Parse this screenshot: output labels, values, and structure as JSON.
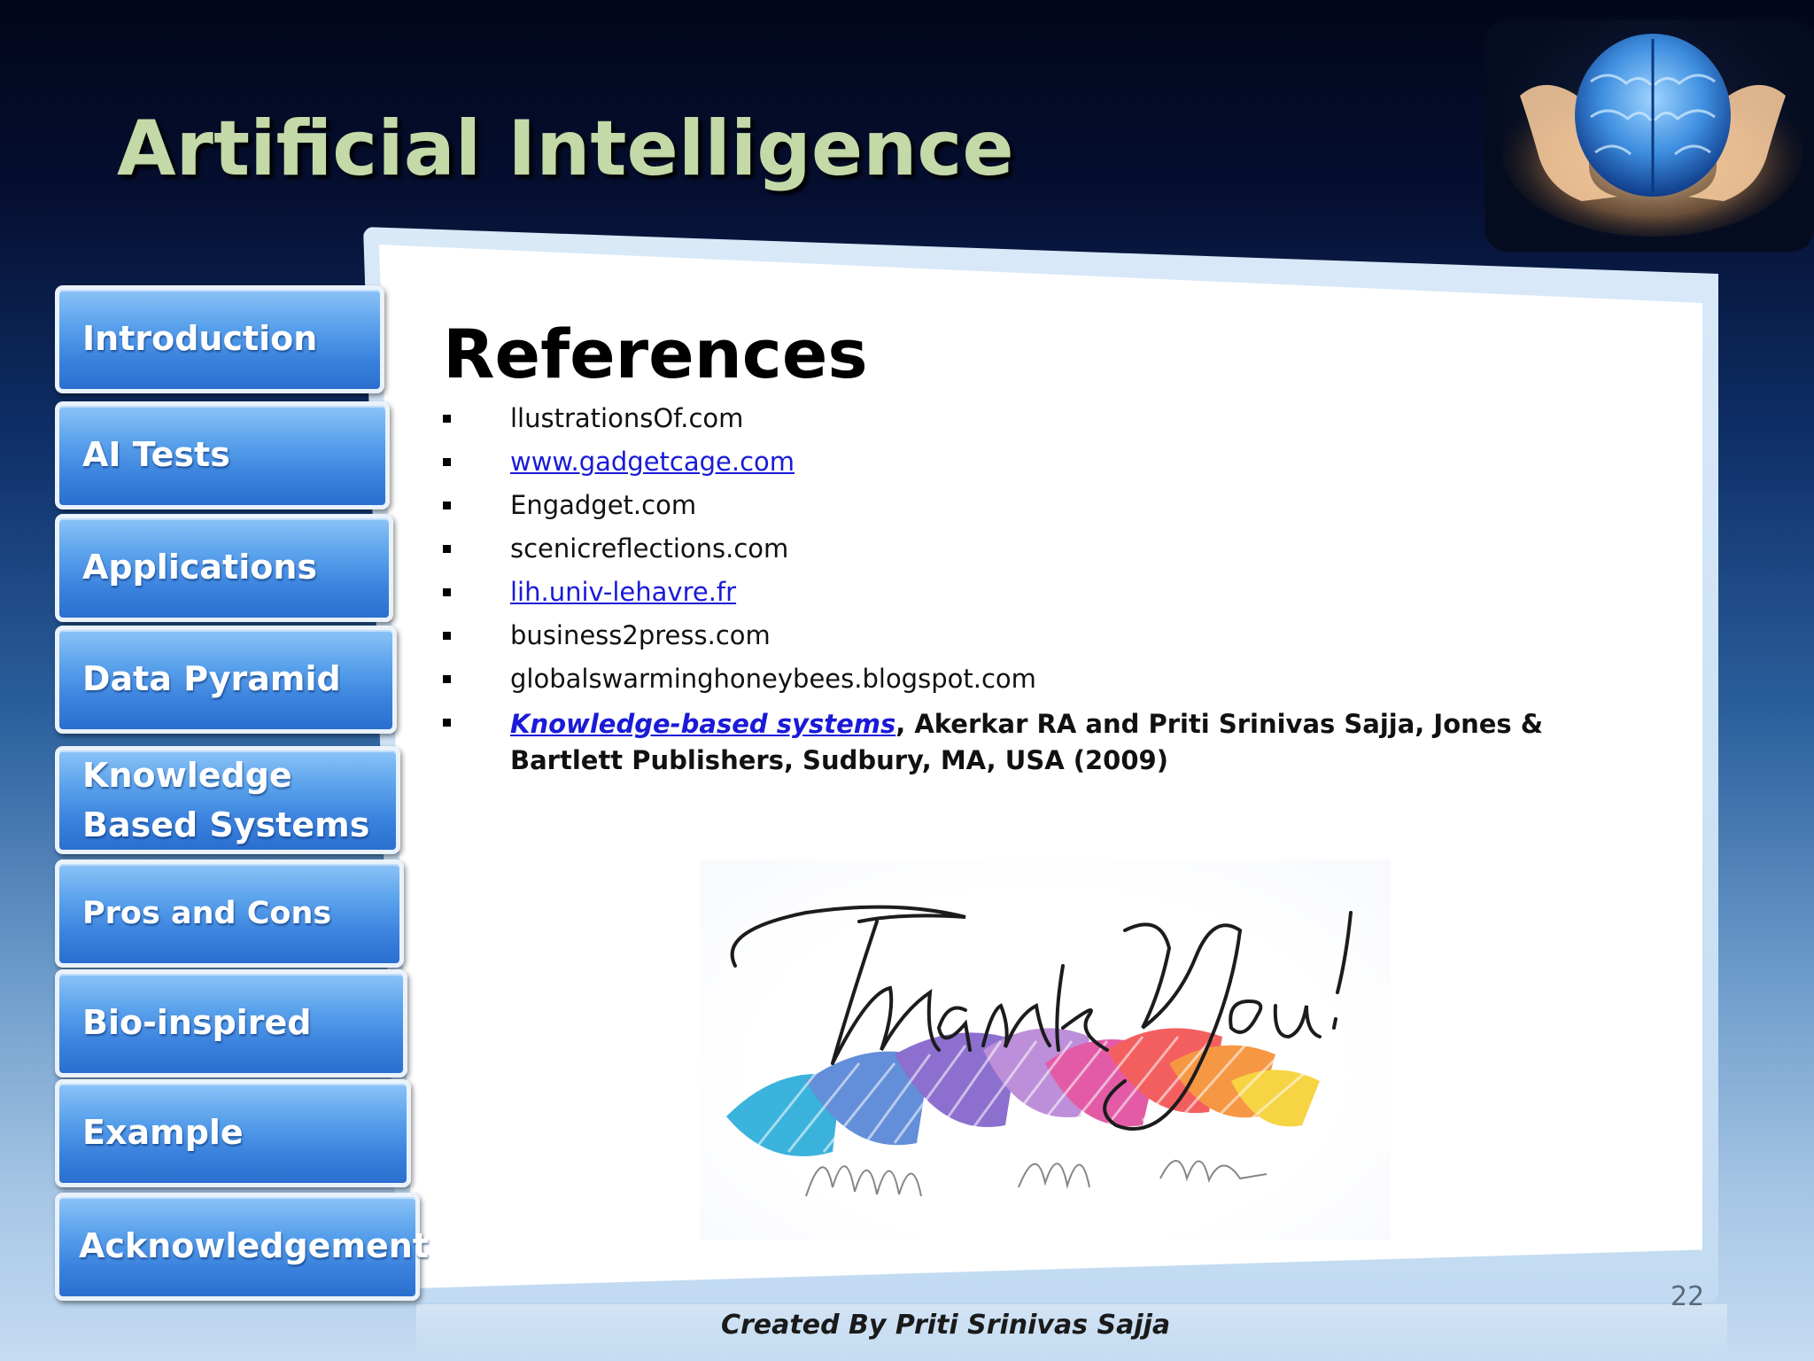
{
  "slide": {
    "title": "Artificial Intelligence",
    "page_number": "22",
    "footer": "Created By Priti Srinivas Sajja"
  },
  "nav": {
    "items": [
      {
        "label": "Introduction"
      },
      {
        "label": "AI Tests"
      },
      {
        "label": "Applications"
      },
      {
        "label": "Data Pyramid"
      },
      {
        "label": "Knowledge Based Systems"
      },
      {
        "label": "Pros and Cons"
      },
      {
        "label": "Bio-inspired"
      },
      {
        "label": "Example"
      },
      {
        "label": "Acknowledgement"
      }
    ]
  },
  "content": {
    "heading": "References",
    "references": [
      {
        "text": "llustrationsOf.com"
      },
      {
        "text": "www.gadgetcage.com"
      },
      {
        "text": "Engadget.com"
      },
      {
        "text": "scenicreflections.com"
      },
      {
        "text": "lih.univ-lehavre.fr"
      },
      {
        "text": "business2press.com"
      },
      {
        "text": "globalswarminghoneybees.blogspot.com"
      }
    ],
    "book": {
      "link_text": "Knowledge-based systems",
      "rest_text": ", Akerkar RA  and Priti Srinivas Sajja, Jones & Bartlett Publishers, Sudbury, MA, USA (2009)"
    }
  },
  "images": {
    "logo": "brain-in-hands",
    "closing": "Thank You!"
  },
  "colors": {
    "title": "#c3d9a8",
    "nav_button": "#3b82de",
    "link": "#1a1ad8"
  }
}
